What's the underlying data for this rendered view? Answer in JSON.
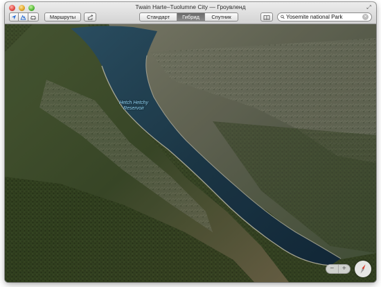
{
  "window": {
    "title": "Twain Harte–Tuolumne City — Гроувленд"
  },
  "toolbar": {
    "location_icon": "location-arrow-icon",
    "threed_icon": "3d-terrain-icon",
    "traffic_icon": "car-icon",
    "routes_label": "Маршруты",
    "share_icon": "share-icon",
    "map_modes": [
      "Стандарт",
      "Гибрид",
      "Спутник"
    ],
    "active_mode": "Гибрид",
    "bookmarks_icon": "book-icon",
    "search_value": "Yosemite national Park",
    "search_icon": "magnifier-icon",
    "clear_icon": "clear-x-icon"
  },
  "map": {
    "label_line1": "Hetch Hetchy",
    "label_line2": "Reservoir",
    "zoom_out": "−",
    "zoom_in": "+",
    "compass_icon": "compass-icon"
  },
  "colors": {
    "active_segment": "#777777",
    "water": "#1d3a4a",
    "label": "#8fd2f2"
  }
}
